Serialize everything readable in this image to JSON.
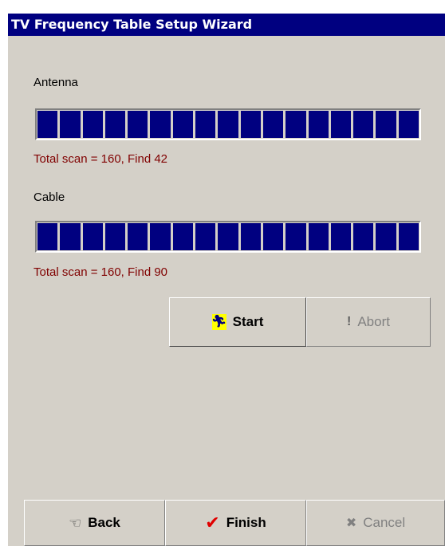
{
  "window": {
    "title": "TV Frequency Table Setup Wizard"
  },
  "antenna": {
    "label": "Antenna",
    "progress": 1.0,
    "status": "Total scan = 160, Find 42"
  },
  "cable": {
    "label": "Cable",
    "progress": 1.0,
    "status": "Total scan = 160, Find 90"
  },
  "scan_buttons": {
    "start_label": "Start",
    "start_icon": "running-man-icon",
    "abort_label": "Abort",
    "abort_icon": "exclamation-icon"
  },
  "footer": {
    "back_label": "Back",
    "back_icon": "pointing-hand-icon",
    "finish_label": "Finish",
    "finish_icon": "checkmark-icon",
    "cancel_label": "Cancel",
    "cancel_icon": "x-icon"
  },
  "colors": {
    "titlebar": "#000080",
    "progress_fill": "#000080",
    "status_text": "#800000",
    "face": "#d4d0c8"
  }
}
